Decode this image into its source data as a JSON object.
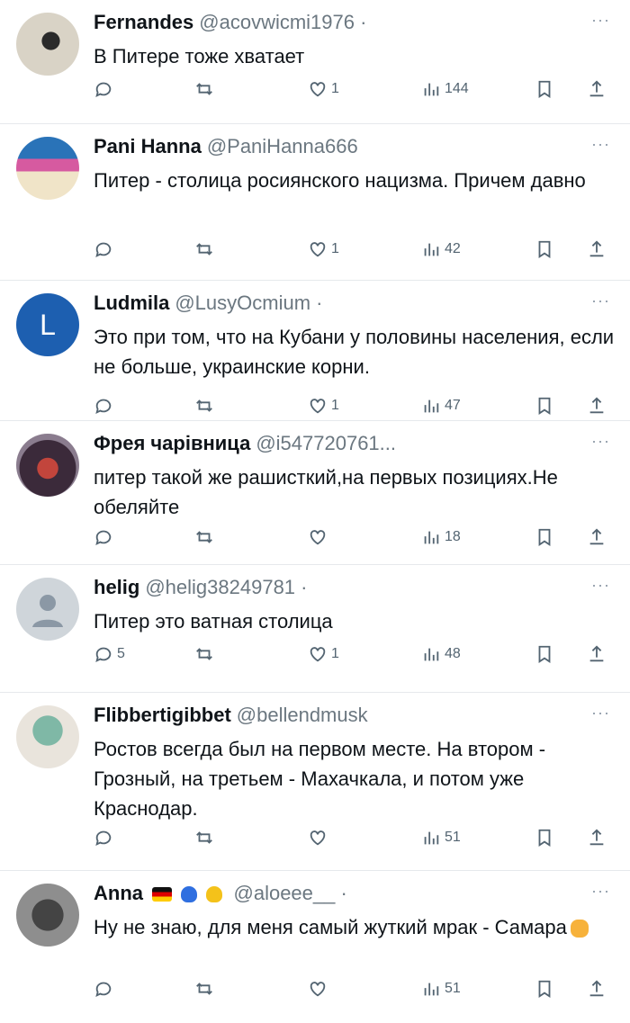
{
  "tweets": [
    {
      "name": "Fernandes",
      "handle": "@acovwicmi1976 ·",
      "text": "В Питере тоже хватает",
      "replies": "",
      "likes": "1",
      "views": "144"
    },
    {
      "name": "Pani Hanna",
      "handle": "@PaniHanna666",
      "text": "Питер - столица росиянского нацизма. Причем давно",
      "replies": "",
      "likes": "1",
      "views": "42"
    },
    {
      "name": "Ludmila",
      "handle": "@LusyOcmium · ",
      "text": "Это при том, что на Кубани у половины населения, если не больше, украинские корни.",
      "replies": "",
      "likes": "1",
      "views": "47",
      "avatar_letter": "L"
    },
    {
      "name": "Фрея чарівница",
      "handle": "@i547720761...",
      "text": "питер такой же рашисткий,на первых позициях.Не обеляйте",
      "replies": "",
      "likes": "",
      "views": "18"
    },
    {
      "name": "helig",
      "handle": "@helig38249781 ·",
      "text": "Питер это ватная столица",
      "replies": "5",
      "likes": "1",
      "views": "48"
    },
    {
      "name": "Flibbertigibbet",
      "handle": "@bellendmusk",
      "text": "Ростов всегда был на первом месте. На втором - Грозный, на третьем - Махачкала, и потом уже Краснодар.",
      "replies": "",
      "likes": "",
      "views": "51"
    },
    {
      "name": "Anna",
      "handle": "@aloeee__ ·",
      "text": "Ну не знаю,  для меня самый жуткий мрак - Самара",
      "replies": "",
      "likes": "",
      "views": "51"
    }
  ],
  "more_label": "···",
  "icons": [
    "reply-icon",
    "retweet-icon",
    "like-icon",
    "views-icon",
    "bookmark-icon",
    "share-icon"
  ],
  "colors": {
    "text": "#0f1419",
    "secondary": "#536471",
    "divider": "#e6e9ec",
    "avatar_blue": "#1d5fb0"
  }
}
